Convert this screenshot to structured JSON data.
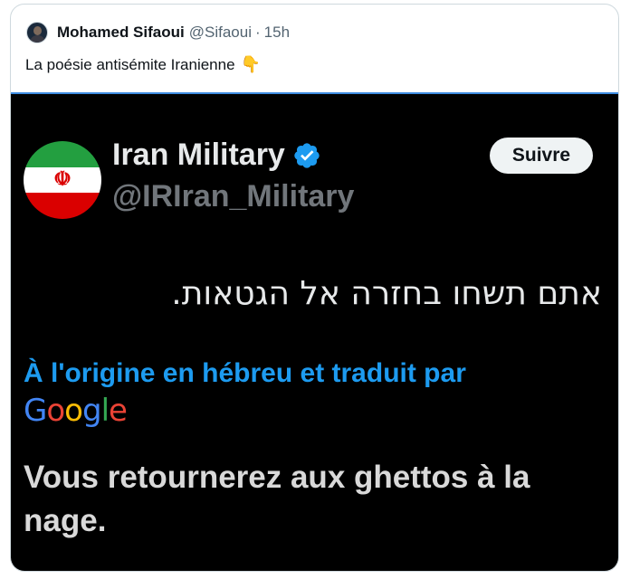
{
  "tweet": {
    "author_name": "Mohamed Sifaoui",
    "author_handle": "@Sifaoui",
    "separator": "·",
    "time": "15h",
    "text": "La poésie antisémite Iranienne",
    "emoji": "👇"
  },
  "embedded": {
    "account_name": "Iran Military",
    "account_handle": "@IRIran_Military",
    "follow_label": "Suivre",
    "hebrew_text": "אתם תשחו בחזרה אל הגטאות.",
    "translated_label": "À l'origine en hébreu et traduit par",
    "google": [
      "G",
      "o",
      "o",
      "g",
      "l",
      "e"
    ],
    "translation": "Vous retournerez aux ghettos à la nage."
  },
  "colors": {
    "link_blue": "#1d9bf0",
    "verified_blue": "#1d9bf0",
    "media_bg": "#000000",
    "flag_green": "#239f40",
    "flag_red": "#da0000"
  },
  "icons": {
    "verified": "verified-badge-icon",
    "emoji": "backhand-index-pointing-down"
  }
}
